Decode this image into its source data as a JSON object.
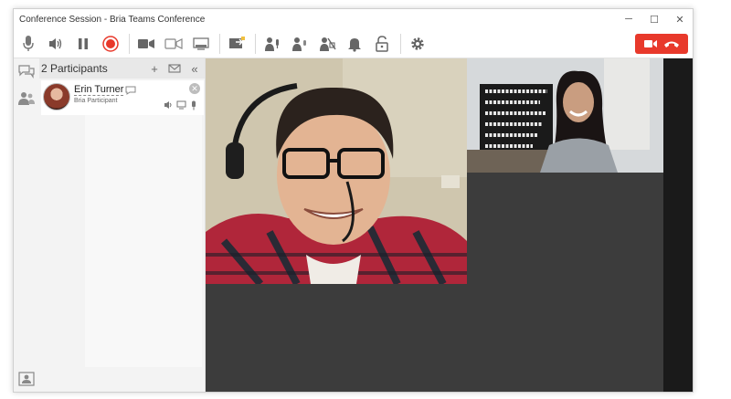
{
  "window": {
    "title": "Conference Session - Bria Teams Conference"
  },
  "window_controls": {
    "minimize": "─",
    "maximize": "☐",
    "close": "✕"
  },
  "toolbar": {
    "buttons": [
      "microphone-icon",
      "speaker-icon",
      "pause-icon",
      "record-icon",
      "video-camera-icon",
      "video-off-icon",
      "screen-share-icon",
      "share-content-icon",
      "mute-all-icon",
      "mute-participant-icon",
      "mute-video-icon",
      "bell-icon",
      "lock-icon",
      "gear-icon"
    ],
    "accent": "#e8392b"
  },
  "participants_panel": {
    "count_label": "2 Participants",
    "add_label": "+",
    "collapse_label": "«",
    "participants": [
      {
        "name": "Erin Turner",
        "role": "Bria Participant"
      }
    ]
  },
  "colors": {
    "end_call": "#e8392b",
    "record": "#e8392b",
    "video_bg": "#3c3c3c"
  }
}
